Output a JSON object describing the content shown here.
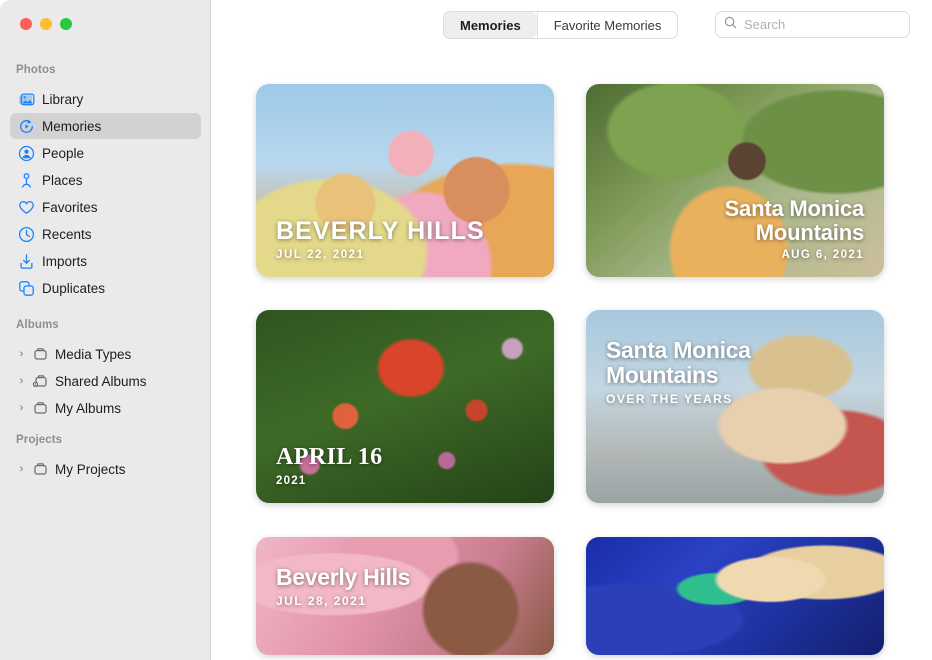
{
  "window": {
    "traffic_lights": [
      {
        "name": "close",
        "color": "#ff5f57"
      },
      {
        "name": "minimize",
        "color": "#febc2e"
      },
      {
        "name": "maximize",
        "color": "#28c840"
      }
    ]
  },
  "sidebar": {
    "sections": [
      {
        "title": "Photos",
        "items": [
          {
            "label": "Library",
            "icon": "photo-stack-icon",
            "selected": false
          },
          {
            "label": "Memories",
            "icon": "memories-icon",
            "selected": true
          },
          {
            "label": "People",
            "icon": "person-circle-icon",
            "selected": false
          },
          {
            "label": "Places",
            "icon": "map-pin-icon",
            "selected": false
          },
          {
            "label": "Favorites",
            "icon": "heart-icon",
            "selected": false
          },
          {
            "label": "Recents",
            "icon": "clock-icon",
            "selected": false
          },
          {
            "label": "Imports",
            "icon": "import-icon",
            "selected": false
          },
          {
            "label": "Duplicates",
            "icon": "duplicates-icon",
            "selected": false
          }
        ]
      },
      {
        "title": "Albums",
        "items": [
          {
            "label": "Media Types",
            "icon": "album-icon",
            "disclosure": "›"
          },
          {
            "label": "Shared Albums",
            "icon": "shared-album-icon",
            "disclosure": "›"
          },
          {
            "label": "My Albums",
            "icon": "album-icon",
            "disclosure": "›"
          }
        ]
      },
      {
        "title": "Projects",
        "items": [
          {
            "label": "My Projects",
            "icon": "album-icon",
            "disclosure": "›"
          }
        ]
      }
    ]
  },
  "toolbar": {
    "tabs": [
      {
        "label": "Memories",
        "active": true
      },
      {
        "label": "Favorite Memories",
        "active": false
      }
    ],
    "search": {
      "placeholder": "Search",
      "value": "",
      "icon": "search-icon"
    }
  },
  "memories": [
    {
      "title": "BEVERLY HILLS",
      "subtitle": "JUL 22, 2021",
      "title_style": "condensed",
      "align": "left",
      "position": "bottom",
      "photo": "ph1"
    },
    {
      "title": "Santa Monica\nMountains",
      "title_line1": "Santa Monica",
      "title_line2": "Mountains",
      "subtitle": "AUG 6, 2021",
      "title_style": "rounded",
      "align": "right",
      "position": "bottom",
      "photo": "ph2"
    },
    {
      "title": "APRIL 16",
      "subtitle": "2021",
      "title_style": "serif",
      "align": "left",
      "position": "bottom",
      "photo": "ph3"
    },
    {
      "title_line1": "Santa Monica",
      "title_line2": "Mountains",
      "subtitle": "OVER THE YEARS",
      "title_style": "sans",
      "align": "left",
      "position": "top",
      "photo": "ph4"
    },
    {
      "title": "Beverly Hills",
      "subtitle": "JUL 28, 2021",
      "title_style": "sans",
      "align": "left",
      "position": "bottom",
      "photo": "ph5"
    },
    {
      "title": "",
      "subtitle": "",
      "title_style": "sans",
      "align": "left",
      "position": "bottom",
      "photo": "ph6"
    }
  ],
  "colors": {
    "sidebar_bg": "#ebeaea",
    "selected_row": "#d3d2d2",
    "accent_icon": "#1a84ff",
    "content_bg": "#ffffff",
    "section_title": "#8e8e8e"
  }
}
